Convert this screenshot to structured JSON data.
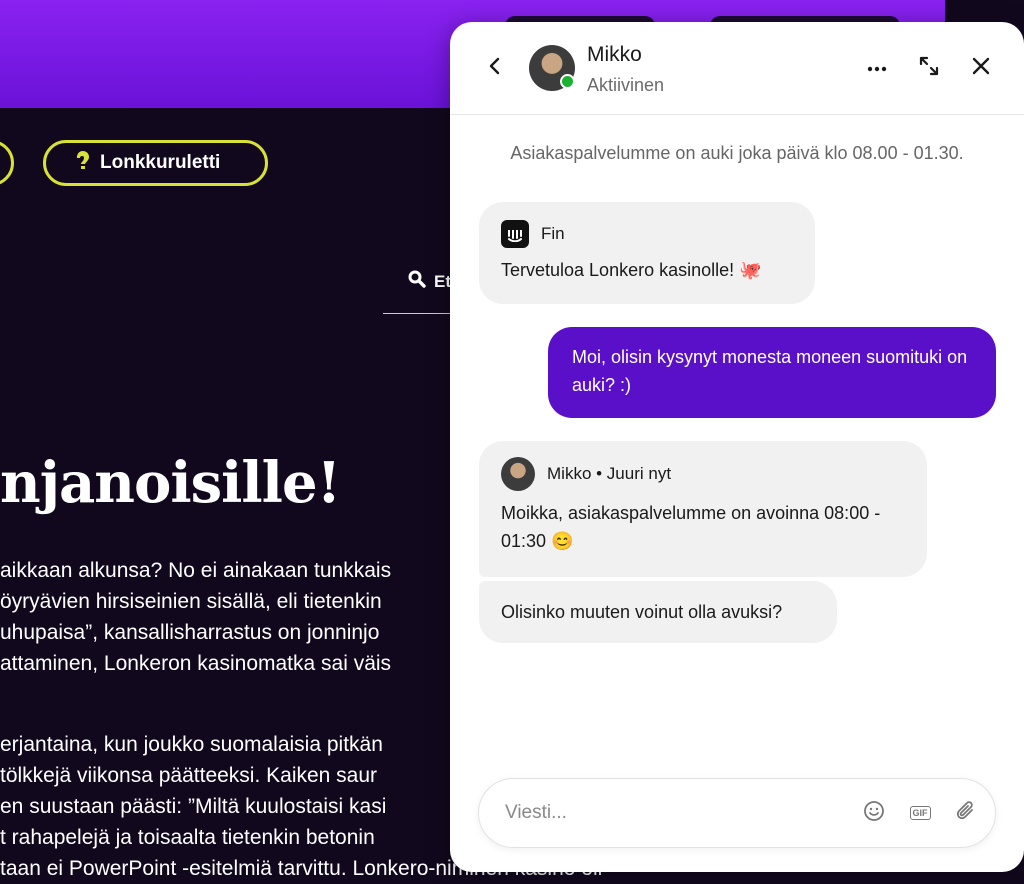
{
  "site": {
    "nav_lonkkuruletti": "Lonkkuruletti",
    "search_label": "Et",
    "hero_title": "njanoisille!",
    "paragraph1": [
      "aikkaan alkunsa? No ei ainakaan tunkkais",
      "öyryävien hirsiseinien sisällä, eli tietenkin",
      "uhupaisa”, kansallisharrastus on jonninjo",
      "attaminen, Lonkeron kasinomatka sai väis"
    ],
    "paragraph2": [
      "erjantaina, kun joukko suomalaisia pitkän",
      "tölkkejä viikonsa päätteeksi. Kaiken saur",
      "en suustaan päästi: ”Miltä kuulostaisi kasi",
      "t rahapelejä ja toisaalta tietenkin betonin",
      "taan ei PowerPoint -esitelmiä tarvittu. Lonkero-niminen kasino oli"
    ]
  },
  "chat": {
    "agent_name": "Mikko",
    "agent_status": "Aktiivinen",
    "hours_note": "Asiakaspalvelumme on auki joka päivä klo 08.00 - 01.30.",
    "messages": {
      "fin_sender": "Fin",
      "fin_text": "Tervetuloa Lonkero kasinolle! 🐙",
      "user_text": "Moi, olisin kysynyt monesta moneen suomituki on auki? :)",
      "mikko_sender": "Mikko • Juuri nyt",
      "mikko_text": "Moikka, asiakaspalvelumme on avoinna 08:00 - 01:30 😊",
      "mikko_text2": "Olisinko muuten voinut olla avuksi?"
    },
    "composer_placeholder": "Viesti...",
    "gif_label": "GIF"
  },
  "colors": {
    "header_purple": "#7a1ae6",
    "accent_yellow": "#d7e233",
    "user_bubble": "#5a10c8",
    "online": "#1bb232"
  },
  "icons": [
    "back-icon",
    "more-icon",
    "expand-icon",
    "close-icon",
    "pin-icon",
    "search-icon",
    "fin-logo",
    "emoji-icon",
    "gif-icon",
    "attach-icon"
  ]
}
